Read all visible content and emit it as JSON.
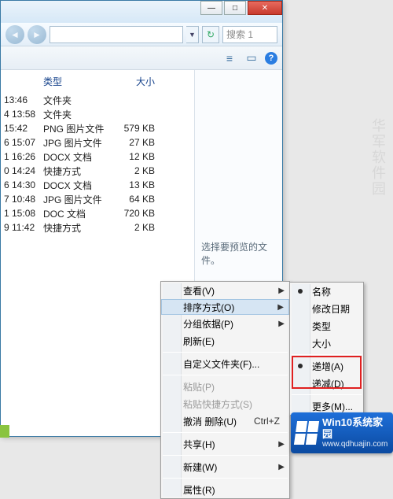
{
  "titlebar": {
    "min": "—",
    "max": "□",
    "close": "✕"
  },
  "nav": {
    "back": "◄",
    "fwd": "►",
    "drop": "▼",
    "refresh": "↻",
    "search_placeholder": "搜索 1",
    "address": ""
  },
  "toolbar": {
    "views": "≡",
    "preview": "▭",
    "help": "?"
  },
  "columns": {
    "time": "",
    "type": "类型",
    "size": "大小"
  },
  "rows": [
    {
      "time": "13:46",
      "type": "文件夹",
      "size": ""
    },
    {
      "time": "4 13:58",
      "type": "文件夹",
      "size": ""
    },
    {
      "time": "15:42",
      "type": "PNG 图片文件",
      "size": "579 KB"
    },
    {
      "time": "6 15:07",
      "type": "JPG 图片文件",
      "size": "27 KB"
    },
    {
      "time": "1 16:26",
      "type": "DOCX 文档",
      "size": "12 KB"
    },
    {
      "time": "0 14:24",
      "type": "快捷方式",
      "size": "2 KB"
    },
    {
      "time": "6 14:30",
      "type": "DOCX 文档",
      "size": "13 KB"
    },
    {
      "time": "7 10:48",
      "type": "JPG 图片文件",
      "size": "64 KB"
    },
    {
      "time": "1 15:08",
      "type": "DOC 文档",
      "size": "720 KB"
    },
    {
      "time": "9 11:42",
      "type": "快捷方式",
      "size": "2 KB"
    }
  ],
  "preview_pane": {
    "text": "选择要预览的文件。"
  },
  "menu1": {
    "view": {
      "label": "查看(V)",
      "arrow": "▶"
    },
    "sort": {
      "label": "排序方式(O)",
      "arrow": "▶"
    },
    "group": {
      "label": "分组依据(P)",
      "arrow": "▶"
    },
    "refresh": {
      "label": "刷新(E)"
    },
    "customize": {
      "label": "自定义文件夹(F)..."
    },
    "paste": {
      "label": "粘贴(P)"
    },
    "paste_shortcut": {
      "label": "粘贴快捷方式(S)"
    },
    "undo": {
      "label": "撤消 删除(U)",
      "shortcut": "Ctrl+Z"
    },
    "share": {
      "label": "共享(H)",
      "arrow": "▶"
    },
    "new": {
      "label": "新建(W)",
      "arrow": "▶"
    },
    "properties": {
      "label": "属性(R)"
    }
  },
  "menu2": {
    "name": {
      "label": "名称"
    },
    "date": {
      "label": "修改日期"
    },
    "type": {
      "label": "类型"
    },
    "size": {
      "label": "大小"
    },
    "asc": {
      "label": "递增(A)"
    },
    "desc": {
      "label": "递减(D)"
    },
    "more": {
      "label": "更多(M)..."
    }
  },
  "watermarks": {
    "win10_title": "Win10系统家园",
    "win10_url": "www.qdhuajin.com",
    "side_wm": "华军软件园"
  }
}
